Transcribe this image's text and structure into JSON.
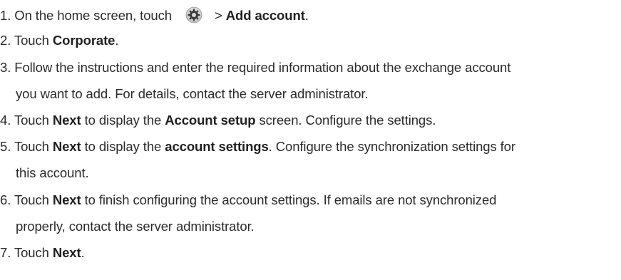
{
  "steps": [
    {
      "number": "1.",
      "t1": " On the home screen, touch ",
      "icon": "settings-gear-icon",
      "t2": " > ",
      "b1": "Add account",
      "t3": "."
    },
    {
      "number": "2.",
      "t1": " Touch ",
      "b1": "Corporate",
      "t2": "."
    },
    {
      "number": "3.",
      "t1": " Follow the instructions and enter the required information about the exchange account",
      "cont": "you want to add. For details, contact the server administrator."
    },
    {
      "number": "4.",
      "t1": " Touch ",
      "b1": "Next",
      "t2": " to display the ",
      "b2": "Account setup",
      "t3": " screen. Configure the settings."
    },
    {
      "number": "5.",
      "t1": " Touch ",
      "b1": "Next",
      "t2": " to display the ",
      "b2": "account settings",
      "t3": ". Configure the synchronization settings for",
      "cont": "this account."
    },
    {
      "number": "6.",
      "t1": " Touch ",
      "b1": "Next",
      "t2": " to finish configuring the account settings. If emails are not synchronized",
      "cont": "properly, contact the server administrator."
    },
    {
      "number": "7.",
      "t1": " Touch ",
      "b1": "Next",
      "t2": "."
    }
  ]
}
